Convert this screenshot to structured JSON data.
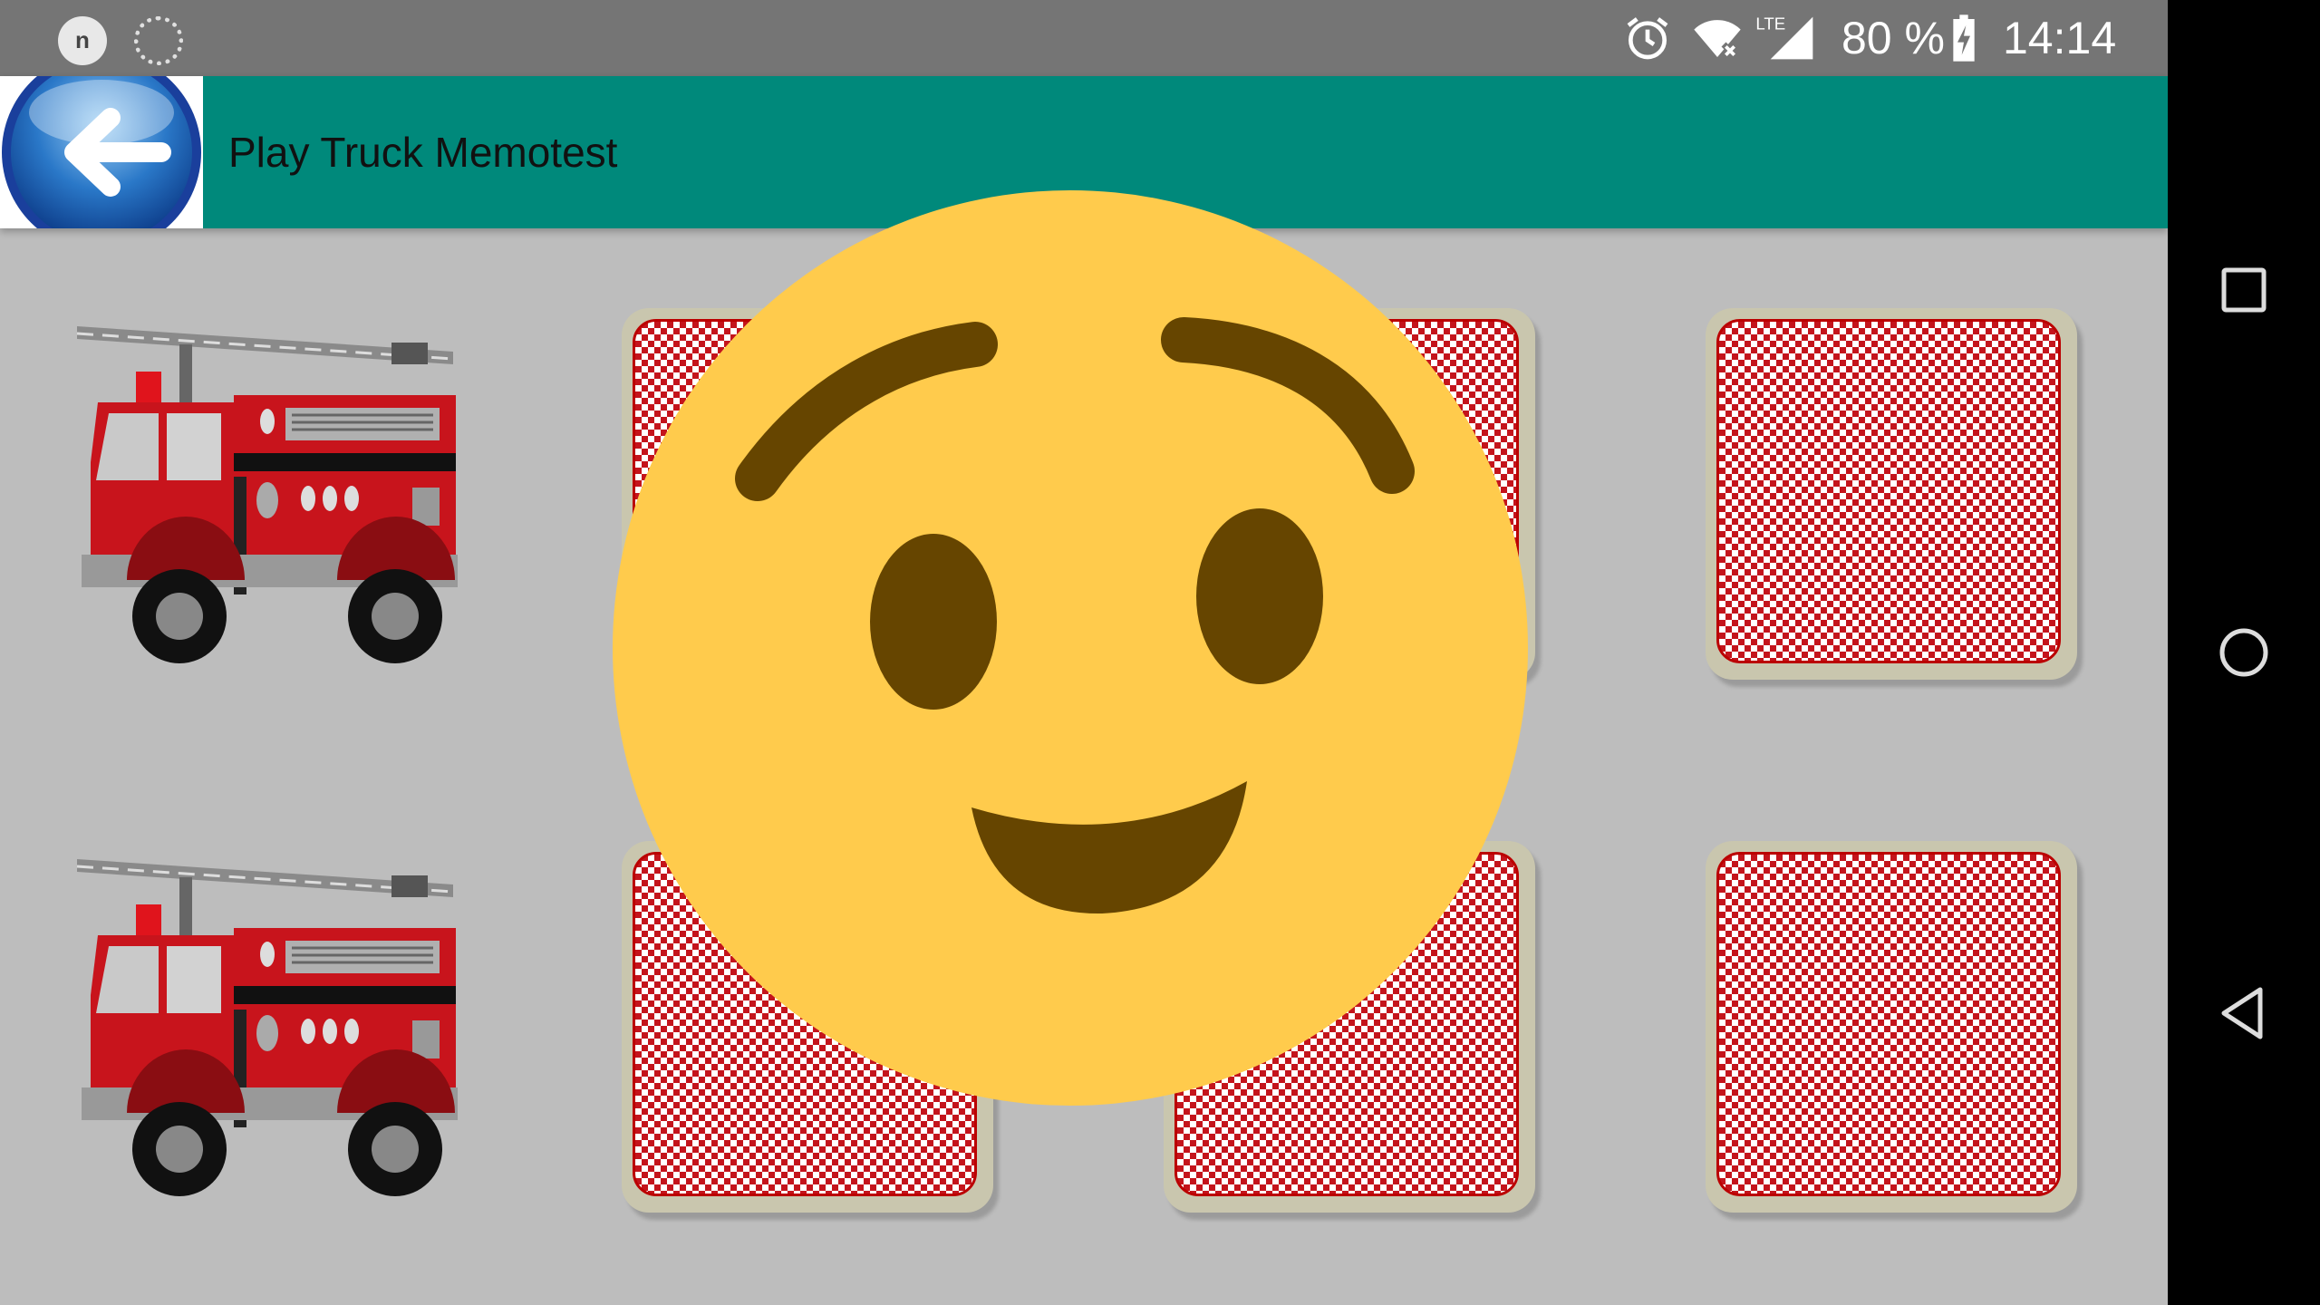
{
  "status_bar": {
    "notification_letter": "n",
    "battery_percent": "80 %",
    "network": "LTE",
    "time": "14:14"
  },
  "toolbar": {
    "title": "Play Truck Memotest",
    "back_icon": "back-arrow-icon"
  },
  "board": {
    "rows": 2,
    "columns": 4,
    "cards": [
      {
        "row": 1,
        "col": 1,
        "state": "revealed",
        "image": "fire-truck"
      },
      {
        "row": 1,
        "col": 2,
        "state": "face-down"
      },
      {
        "row": 1,
        "col": 3,
        "state": "face-down"
      },
      {
        "row": 1,
        "col": 4,
        "state": "face-down"
      },
      {
        "row": 2,
        "col": 1,
        "state": "revealed",
        "image": "fire-truck"
      },
      {
        "row": 2,
        "col": 2,
        "state": "face-down"
      },
      {
        "row": 2,
        "col": 3,
        "state": "face-down"
      },
      {
        "row": 2,
        "col": 4,
        "state": "face-down"
      }
    ]
  },
  "overlay": {
    "icon": "smiling-face-emoji"
  },
  "colors": {
    "toolbar": "#00897b",
    "status_bar": "#757575",
    "board_background": "#bdbdbd",
    "card_pattern_red": "#c4141c",
    "emoji_yellow": "#ffcb4c",
    "emoji_brown": "#664500"
  },
  "nav_bar": {
    "buttons": [
      "recents-icon",
      "home-icon",
      "back-icon"
    ]
  }
}
